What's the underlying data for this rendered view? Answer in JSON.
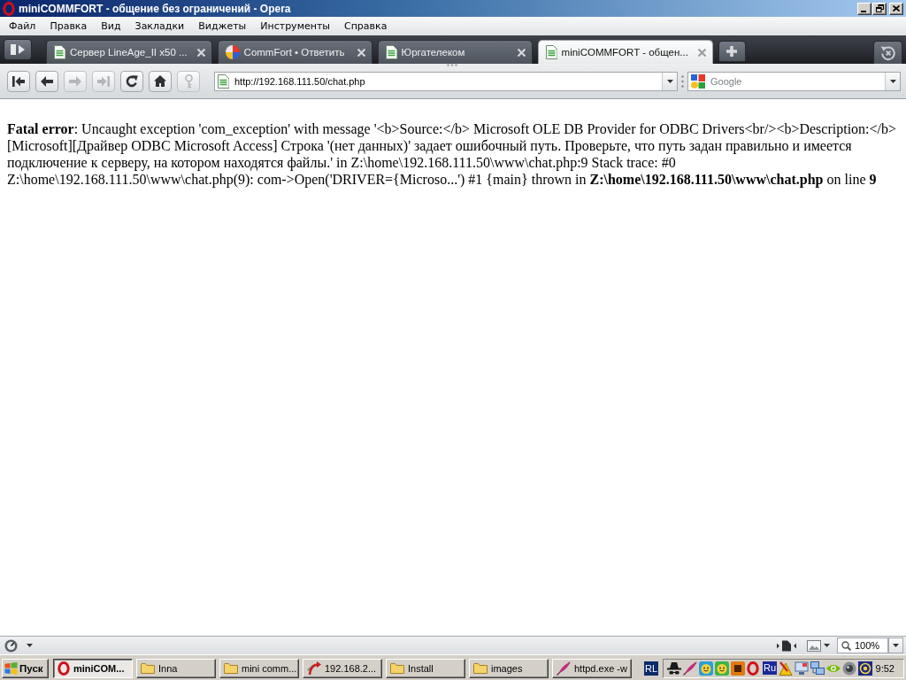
{
  "window": {
    "title": "miniCOMMFORT - общение без ограничений - Opera"
  },
  "menu": [
    "Файл",
    "Правка",
    "Вид",
    "Закладки",
    "Виджеты",
    "Инструменты",
    "Справка"
  ],
  "tabs": [
    {
      "title": "Сервер LineAge_II x50 ...",
      "kind": "page",
      "selected": false
    },
    {
      "title": "CommFort • Ответить",
      "kind": "site",
      "selected": false
    },
    {
      "title": "Юргателеком",
      "kind": "page",
      "selected": false
    },
    {
      "title": "miniCOMMFORT - общен...",
      "kind": "page",
      "selected": true
    }
  ],
  "toolbar": {
    "buttons": [
      {
        "kind": "rewind",
        "disabled": false
      },
      {
        "kind": "back",
        "disabled": false
      },
      {
        "kind": "forward",
        "disabled": true
      },
      {
        "kind": "fast_forward",
        "disabled": true
      },
      {
        "kind": "reload",
        "disabled": false
      },
      {
        "kind": "home",
        "disabled": false
      },
      {
        "kind": "security",
        "disabled": true
      }
    ],
    "address": {
      "value": "http://192.168.111.50/chat.php"
    },
    "search": {
      "placeholder": "Google"
    }
  },
  "page": {
    "error": "**Fatal error**: Uncaught exception 'com_exception' with message '<b>Source:</b> Microsoft OLE DB Provider for ODBC Drivers<br/><b>Description:</b> [Microsoft][Драйвер ODBC Microsoft Access] Строка '(нет данных)' задает ошибочный путь. Проверьте, что путь задан правильно и имеется подключение к серверу, на котором находятся файлы.' in Z:\\home\\192.168.111.50\\www\\chat.php:9 Stack trace: #0 Z:\\home\\192.168.111.50\\www\\chat.php(9): com->Open('DRIVER={Microso...') #1 {main} thrown in **Z:\\home\\192.168.111.50\\www\\chat.php** on line **9**"
  },
  "status_bar": {
    "zoom": "100%"
  },
  "taskbar": {
    "start": "Пуск",
    "tasks": [
      {
        "label": "miniCOM...",
        "kind": "browser",
        "selected": true
      },
      {
        "label": "Inna",
        "kind": "folder",
        "selected": false
      },
      {
        "label": "mini comm...",
        "kind": "folder",
        "selected": false
      },
      {
        "label": "192.168.2...",
        "kind": "connection",
        "selected": false
      },
      {
        "label": "Install",
        "kind": "folder",
        "selected": false
      },
      {
        "label": "images",
        "kind": "folder",
        "selected": false
      },
      {
        "label": "httpd.exe -w",
        "kind": "server",
        "selected": false
      }
    ],
    "tray": {
      "language": "RL",
      "layout": "Ru",
      "clock": "9:52"
    }
  }
}
